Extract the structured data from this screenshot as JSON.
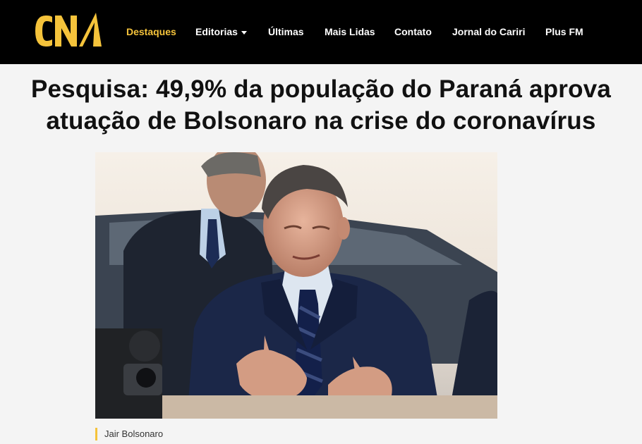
{
  "header": {
    "logo_text": "CN",
    "nav": [
      {
        "label": "Destaques",
        "active": true
      },
      {
        "label": "Editorias",
        "has_dropdown": true
      },
      {
        "label": "Últimas"
      },
      {
        "label": "Mais Lidas"
      },
      {
        "label": "Contato"
      },
      {
        "label": "Jornal do Cariri"
      },
      {
        "label": "Plus FM"
      }
    ]
  },
  "article": {
    "headline": "Pesquisa: 49,9% da população do Paraná aprova atuação de Bolsonaro na crise do coronavírus",
    "photo_caption": "Jair Bolsonaro"
  },
  "colors": {
    "accent": "#f5c33b",
    "navbar_bg": "#000000",
    "page_bg": "#f4f4f4"
  }
}
